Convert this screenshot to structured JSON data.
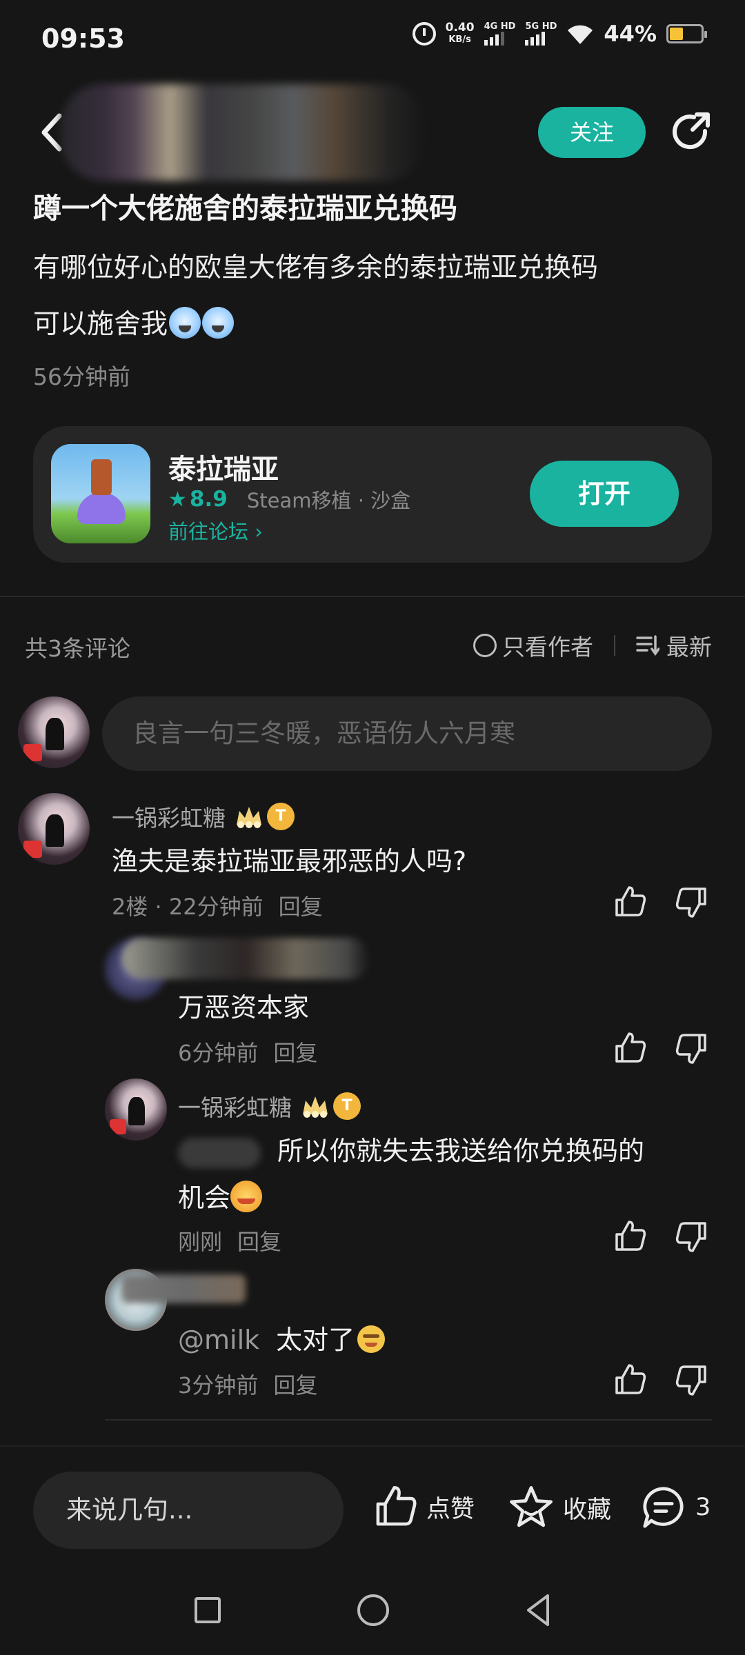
{
  "status_bar": {
    "time": "09:53",
    "net_speed": "0.40",
    "net_unit": "KB/s",
    "sim1": "4G HD",
    "sim2": "5G HD",
    "battery": "44%"
  },
  "header": {
    "follow_label": "关注"
  },
  "post": {
    "title": "蹲一个大佬施舍的泰拉瑞亚兑换码",
    "body_line1": "有哪位好心的欧皇大佬有多余的泰拉瑞亚兑换码",
    "body_line2": "可以施舍我",
    "time": "56分钟前"
  },
  "app_card": {
    "name": "泰拉瑞亚",
    "rating": "8.9",
    "tags": "Steam移植 · 沙盒",
    "link": "前往论坛",
    "open_label": "打开"
  },
  "comments_header": {
    "count": "共3条评论",
    "author_only": "只看作者",
    "sort": "最新"
  },
  "comment_input": {
    "placeholder": "良言一句三冬暖，恶语伤人六月寒"
  },
  "comments": [
    {
      "user": "一锅彩虹糖",
      "text": "渔夫是泰拉瑞亚最邪恶的人吗?",
      "floor": "2楼",
      "time": "22分钟前",
      "reply": "回复"
    },
    {
      "user": "",
      "text": "万恶资本家",
      "time": "6分钟前",
      "reply": "回复"
    },
    {
      "user": "一锅彩虹糖",
      "text_line1": "所以你就失去我送给你兑换码的",
      "text_line2": "机会",
      "time": "刚刚",
      "reply": "回复"
    },
    {
      "user": "",
      "mention": "@milk",
      "text": "太对了",
      "time": "3分钟前",
      "reply": "回复"
    }
  ],
  "bottom_bar": {
    "say_placeholder": "来说几句...",
    "like": "点赞",
    "collect": "收藏",
    "comment_count": "3"
  },
  "badge_letter": "T",
  "colors": {
    "accent": "#19b3a0",
    "background": "#161616",
    "card": "#262626"
  }
}
